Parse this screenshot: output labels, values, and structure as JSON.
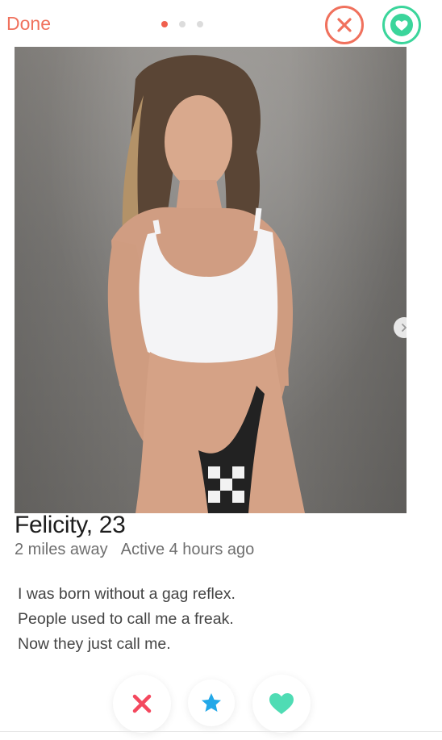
{
  "header": {
    "done_label": "Done",
    "page_dots_count": 3,
    "active_dot_index": 0
  },
  "profile": {
    "name_age": "Felicity, 23",
    "distance": "2 miles away",
    "active": "Active 4 hours ago",
    "bio_lines": [
      "I was born without a gag reflex.",
      "People used to call me a freak.",
      "Now they just call me."
    ]
  },
  "icons": {
    "top_nope": "close-circle-icon",
    "top_like": "heart-circle-icon",
    "next_photo": "chevron-right-icon",
    "action_nope": "x-icon",
    "action_superlike": "star-icon",
    "action_like": "heart-icon"
  },
  "colors": {
    "accent_red": "#f0715d",
    "accent_green": "#3bd59b",
    "star_blue": "#22a8e8",
    "like_green": "#4fdcb4"
  }
}
